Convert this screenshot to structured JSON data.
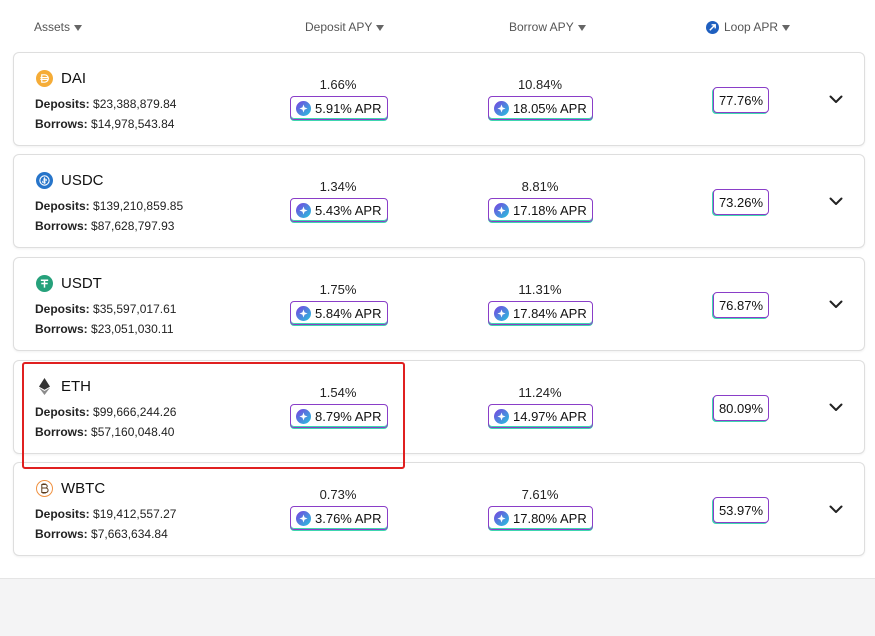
{
  "header": {
    "assets": "Assets",
    "deposit_apy": "Deposit APY",
    "borrow_apy": "Borrow APY",
    "loop_apr": "Loop APR"
  },
  "icons": {
    "loop": "loop-logo-icon",
    "apr_badge": "star-badge-icon",
    "expand": "chevron-down-icon"
  },
  "colors": {
    "dai": "#f5ac37",
    "usdc": "#2775ca",
    "usdt": "#26a17b",
    "eth": "#343434",
    "wbtc": "#f09242",
    "highlight": "#e02020"
  },
  "rows": [
    {
      "name": "DAI",
      "icon": "dai-icon",
      "deposits_label": "Deposits:",
      "deposits": "$23,388,879.84",
      "borrows_label": "Borrows:",
      "borrows": "$14,978,543.84",
      "deposit_apy": "1.66%",
      "deposit_apr": "5.91% APR",
      "borrow_apy": "10.84%",
      "borrow_apr": "18.05% APR",
      "loop_apr": "77.76%"
    },
    {
      "name": "USDC",
      "icon": "usdc-icon",
      "deposits_label": "Deposits:",
      "deposits": "$139,210,859.85",
      "borrows_label": "Borrows:",
      "borrows": "$87,628,797.93",
      "deposit_apy": "1.34%",
      "deposit_apr": "5.43% APR",
      "borrow_apy": "8.81%",
      "borrow_apr": "17.18% APR",
      "loop_apr": "73.26%"
    },
    {
      "name": "USDT",
      "icon": "usdt-icon",
      "deposits_label": "Deposits:",
      "deposits": "$35,597,017.61",
      "borrows_label": "Borrows:",
      "borrows": "$23,051,030.11",
      "deposit_apy": "1.75%",
      "deposit_apr": "5.84% APR",
      "borrow_apy": "11.31%",
      "borrow_apr": "17.84% APR",
      "loop_apr": "76.87%"
    },
    {
      "name": "ETH",
      "icon": "eth-icon",
      "deposits_label": "Deposits:",
      "deposits": "$99,666,244.26",
      "borrows_label": "Borrows:",
      "borrows": "$57,160,048.40",
      "deposit_apy": "1.54%",
      "deposit_apr": "8.79% APR",
      "borrow_apy": "11.24%",
      "borrow_apr": "14.97% APR",
      "loop_apr": "80.09%"
    },
    {
      "name": "WBTC",
      "icon": "wbtc-icon",
      "deposits_label": "Deposits:",
      "deposits": "$19,412,557.27",
      "borrows_label": "Borrows:",
      "borrows": "$7,663,634.84",
      "deposit_apy": "0.73%",
      "deposit_apr": "3.76% APR",
      "borrow_apy": "7.61%",
      "borrow_apr": "17.80% APR",
      "loop_apr": "53.97%"
    }
  ]
}
